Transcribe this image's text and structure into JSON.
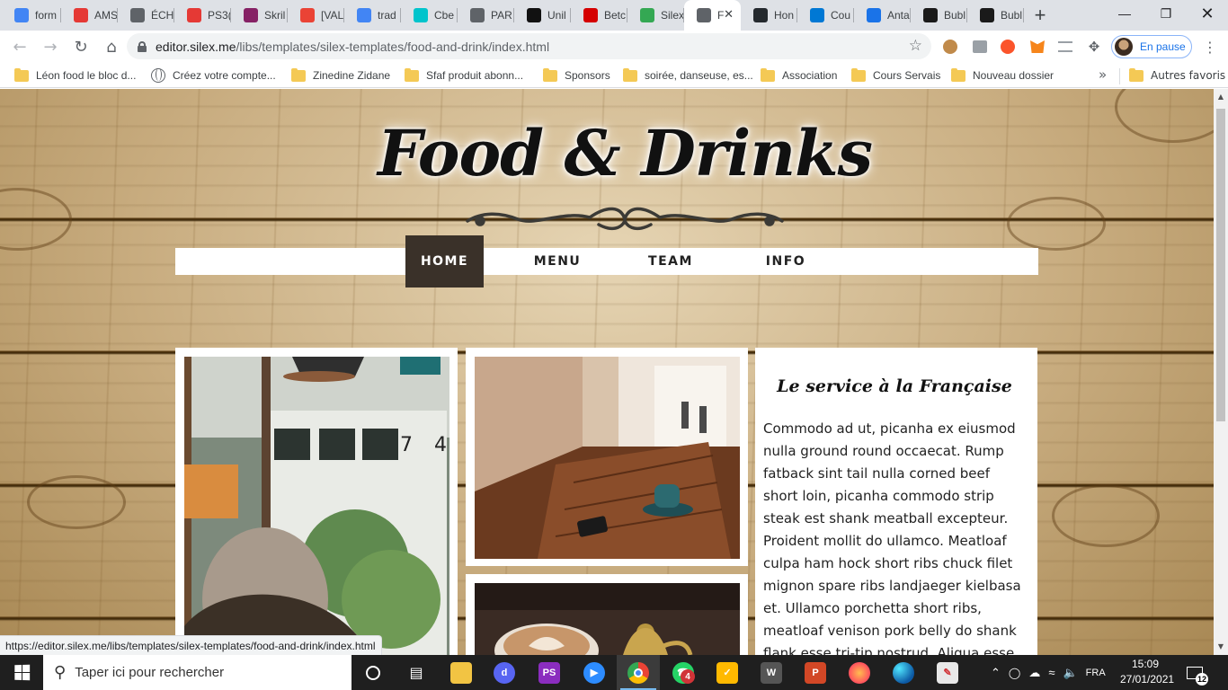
{
  "browser": {
    "tabs": [
      {
        "title": "form",
        "icon": "colored-square-icon",
        "color": "#4285f4"
      },
      {
        "title": "AMS",
        "icon": "ac-logo-icon",
        "color": "#e53935"
      },
      {
        "title": "ÉCH",
        "icon": "globe-icon",
        "color": "#5f6368"
      },
      {
        "title": "PS3(",
        "icon": "ps-logo-icon",
        "color": "#e53935"
      },
      {
        "title": "Skril",
        "icon": "s-logo-icon",
        "color": "#862165"
      },
      {
        "title": "[VAL",
        "icon": "gmail-icon",
        "color": "#ea4335"
      },
      {
        "title": "trad",
        "icon": "google-icon",
        "color": "#4285f4"
      },
      {
        "title": "Cbe",
        "icon": "c-logo-icon",
        "color": "#00c4cc"
      },
      {
        "title": "PAR",
        "icon": "globe-icon",
        "color": "#5f6368"
      },
      {
        "title": "Unil",
        "icon": "u-logo-icon",
        "color": "#111111"
      },
      {
        "title": "Betc",
        "icon": "betclic-icon",
        "color": "#d50000"
      },
      {
        "title": "Silex",
        "icon": "silex-icon",
        "color": "#34a853"
      },
      {
        "title": "F",
        "icon": "globe-icon",
        "color": "#5f6368",
        "active": true
      },
      {
        "title": "Hon",
        "icon": "github-icon",
        "color": "#24292e"
      },
      {
        "title": "Cou",
        "icon": "outlook-icon",
        "color": "#0078d4"
      },
      {
        "title": "Anta",
        "icon": "a-logo-icon",
        "color": "#1a73e8"
      },
      {
        "title": "Bubl",
        "icon": "bubble-icon",
        "color": "#1a1a1a"
      },
      {
        "title": "Bubl",
        "icon": "bubble-icon",
        "color": "#1a1a1a"
      }
    ],
    "new_tab": "+",
    "url_host": "editor.silex.me",
    "url_path": "/libs/templates/silex-templates/food-and-drink/index.html",
    "profile_label": "En pause",
    "bookmarks": [
      {
        "label": "Léon food le bloc d...",
        "icon": "folder-icon"
      },
      {
        "label": "Créez votre compte...",
        "icon": "globe-icon"
      },
      {
        "label": "Zinedine Zidane",
        "icon": "folder-icon"
      },
      {
        "label": "Sfaf produit abonn...",
        "icon": "folder-icon"
      },
      {
        "label": "Sponsors",
        "icon": "folder-icon"
      },
      {
        "label": "soirée, danseuse, es...",
        "icon": "folder-icon"
      },
      {
        "label": "Association",
        "icon": "folder-icon"
      },
      {
        "label": "Cours Servais",
        "icon": "folder-icon"
      },
      {
        "label": "Nouveau dossier",
        "icon": "folder-icon"
      }
    ],
    "bookmarks_overflow": "»",
    "other_bookmarks": "Autres favoris",
    "status_url": "https://editor.silex.me/libs/templates/silex-templates/food-and-drink/index.html"
  },
  "site": {
    "title": "Food & Drinks",
    "nav": [
      {
        "label": "HOME",
        "active": true
      },
      {
        "label": "MENU",
        "active": false
      },
      {
        "label": "TEAM",
        "active": false
      },
      {
        "label": "INFO",
        "active": false
      }
    ],
    "service_title": "Le service à la Française",
    "service_text": "Commodo ad ut, picanha ex eiusmod nulla ground round occaecat. Rump fatback sint tail nulla corned beef short loin, picanha commodo strip steak est shank meatball excepteur. Proident mollit do ullamco. Meatloaf culpa ham hock short ribs chuck filet mignon spare ribs landjaeger kielbasa et. Ullamco porchetta short ribs, meatloaf venison pork belly do shank flank esse tri-tip nostrud. Aliqua esse minim bacon eu nulla fatback pariatur kielbasa pork chop"
  },
  "taskbar": {
    "search_placeholder": "Taper ici pour rechercher",
    "time": "15:09",
    "date": "27/01/2021",
    "whatsapp_badge": "4",
    "notifications": "12"
  }
}
